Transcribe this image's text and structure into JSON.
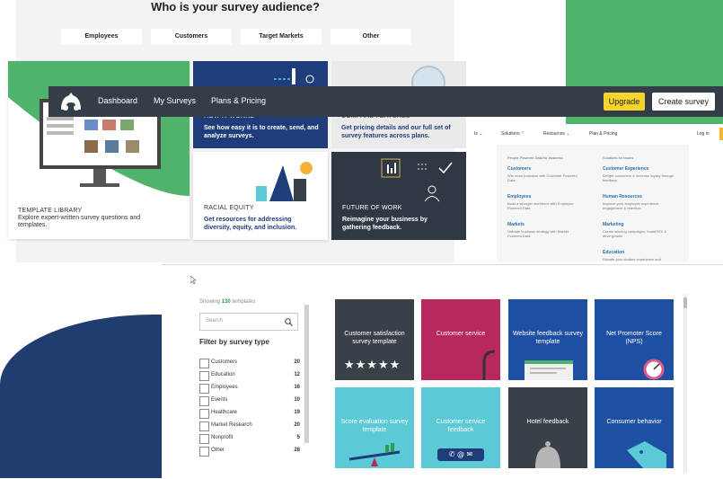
{
  "audience": {
    "heading": "Who is your survey audience?",
    "options": [
      "Employees",
      "Customers",
      "Target Markets",
      "Other"
    ]
  },
  "cards": {
    "template_library": {
      "title": "TEMPLATE LIBRARY",
      "desc": "Explore expert-written survey questions and templates."
    },
    "how_it_works": {
      "title": "HOW IT WORKS",
      "desc": "See how easy it is to create, send, and analyze surveys."
    },
    "compare_features": {
      "title": "COMPARE FEATURES",
      "desc": "Get pricing details and our full set of survey features across plans."
    },
    "racial_equity": {
      "title": "RACIAL EQUITY",
      "desc": "Get resources for addressing diversity, equity, and inclusion."
    },
    "future_of_work": {
      "title": "FUTURE OF WORK",
      "desc": "Reimagine your business by gathering feedback."
    }
  },
  "navbar": {
    "items": [
      "Dashboard",
      "My Surveys",
      "Plans & Pricing"
    ],
    "upgrade": "Upgrade",
    "create": "Create survey"
  },
  "solutions_menu": {
    "bar": {
      "products": "ts ⌄",
      "solutions": "Solutions ⌃",
      "resources": "Resources ⌄",
      "plans": "Plan & Pricing",
      "login": "Log in"
    },
    "col1_heading": "People Powered Data for business",
    "col2_heading": "Solutions for teams",
    "col1": [
      {
        "title": "Customers",
        "desc": "Win more business with Customer Powered Data"
      },
      {
        "title": "Employees",
        "desc": "Build a stronger workforce with Employee Powered Data"
      },
      {
        "title": "Markets",
        "desc": "Validate business strategy with Market Powered Data"
      }
    ],
    "col2": [
      {
        "title": "Customer Experience",
        "desc": "Delight customers & increase loyalty through feedback"
      },
      {
        "title": "Human Resources",
        "desc": "Improve your employee experience, engagement & retention"
      },
      {
        "title": "Marketing",
        "desc": "Create winning campaigns, boost ROI & drive growth"
      },
      {
        "title": "Education",
        "desc": "Elevate your student experience and"
      }
    ]
  },
  "browser": {
    "showing_prefix": "Showing",
    "showing_count": "130",
    "showing_suffix": "templates",
    "search_placeholder": "Search",
    "filter_heading": "Filter by survey type",
    "filters": [
      {
        "label": "Customers",
        "count": "20"
      },
      {
        "label": "Education",
        "count": "12"
      },
      {
        "label": "Employees",
        "count": "16"
      },
      {
        "label": "Events",
        "count": "10"
      },
      {
        "label": "Healthcare",
        "count": "19"
      },
      {
        "label": "Market Research",
        "count": "20"
      },
      {
        "label": "Nonprofit",
        "count": "5"
      },
      {
        "label": "Other",
        "count": "28"
      }
    ],
    "templates": [
      {
        "label": "Customer satisfaction survey template",
        "color": "#3a4047"
      },
      {
        "label": "Customer service",
        "color": "#b8285f"
      },
      {
        "label": "Website feedback survey template",
        "color": "#1f4fa3"
      },
      {
        "label": "Net Promoter Score (NPS)",
        "color": "#1f4fa3"
      },
      {
        "label": "Score evaluation survey template",
        "color": "#5bc9d6"
      },
      {
        "label": "Customer service feedback",
        "color": "#5bc9d6"
      },
      {
        "label": "Hotel feedback",
        "color": "#3a4047"
      },
      {
        "label": "Consumer behavior",
        "color": "#1f4fa3"
      }
    ]
  },
  "colors": {
    "brand_green": "#4fb36b",
    "nav_dark": "#333e48",
    "upgrade_yellow": "#f5d42c",
    "navy": "#1f3d6e"
  }
}
